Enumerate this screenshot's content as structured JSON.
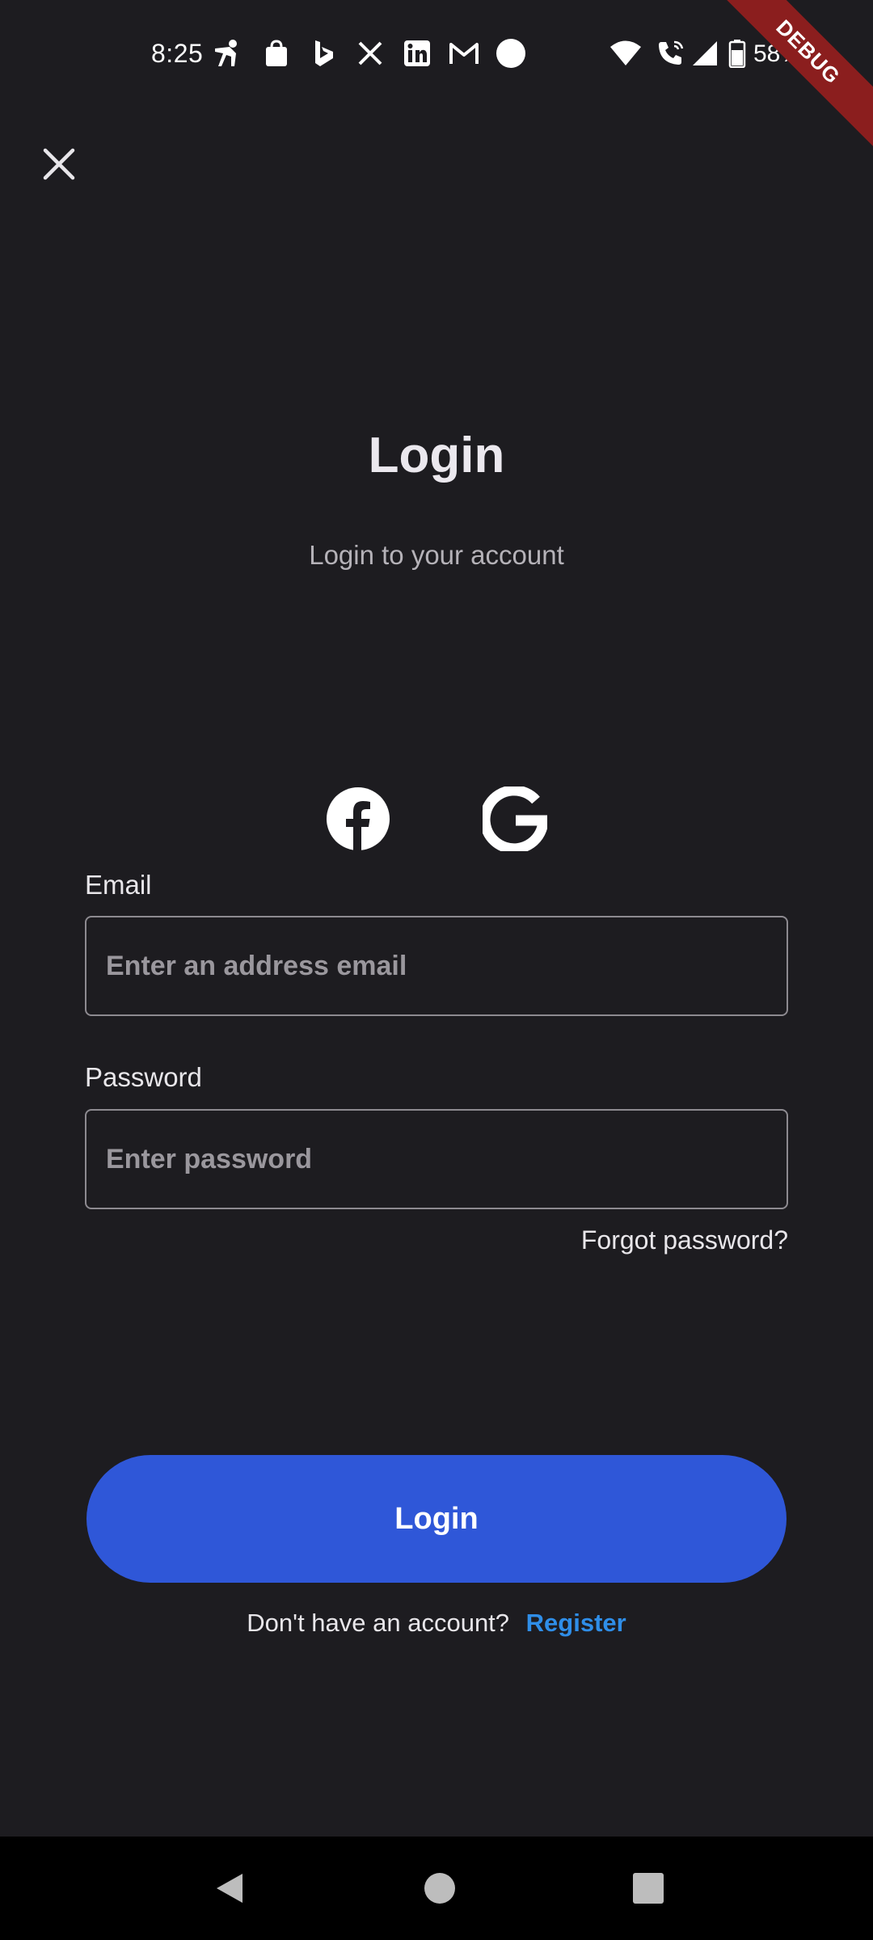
{
  "status_bar": {
    "time": "8:25",
    "battery": "58%",
    "notification_icons": [
      "fitness-app-icon",
      "shopping-bag-icon",
      "bing-icon",
      "x-icon",
      "linkedin-icon",
      "gmail-icon",
      "circle-icon"
    ],
    "system_icons": [
      "wifi-icon",
      "wifi-calling-icon",
      "signal-icon",
      "battery-icon"
    ]
  },
  "debug_banner": "DEBUG",
  "header": {
    "close_icon": "close-icon"
  },
  "title": "Login",
  "subtitle": "Login to your account",
  "social": {
    "facebook_icon": "facebook-icon",
    "google_icon": "google-icon"
  },
  "form": {
    "email_label": "Email",
    "email_placeholder": "Enter an address email",
    "email_value": "",
    "password_label": "Password",
    "password_placeholder": "Enter password",
    "password_value": "",
    "forgot_password": "Forgot password?"
  },
  "login_button": "Login",
  "register": {
    "prompt": "Don't have an account?",
    "link": "Register"
  },
  "colors": {
    "background": "#1d1c20",
    "primary": "#2f57d8",
    "link": "#2f8ee8",
    "debug_ribbon": "#8b1e1e"
  },
  "nav_bar": [
    "back-icon",
    "home-icon",
    "recents-icon"
  ]
}
